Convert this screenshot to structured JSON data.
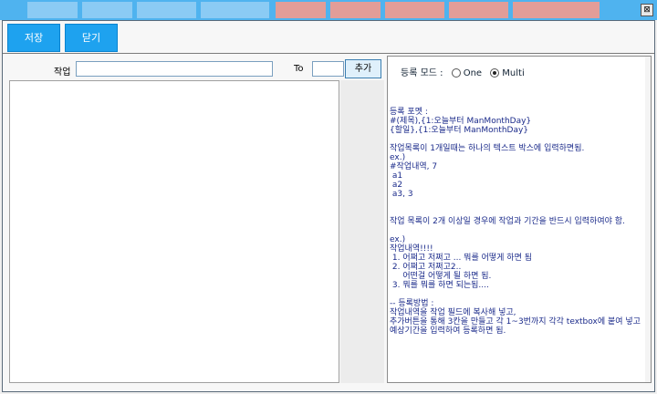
{
  "window": {
    "close_glyph": "⊠"
  },
  "toolbar": {
    "save_label": "저장",
    "close_label": "닫기"
  },
  "form": {
    "task_label": "작업",
    "task_value": "",
    "to_label": "To",
    "to_value": "",
    "add_label": "추가"
  },
  "mode": {
    "label": "등록 모드 :",
    "options": [
      "One",
      "Multi"
    ],
    "selected": "Multi"
  },
  "guide_text": "등록 포멧 :\n#(제목),{1:오늘부터 ManMonthDay}\n{할일},{1:오늘부터 ManMonthDay}\n\n작업목록이 1개일때는 하나의 텍스트 박스에 입력하면됨.\nex.)\n#작업내역, 7\n a1\n a2\n a3, 3\n\n\n작업 목록이 2개 이상일 경우에 작업과 기간을 반드시 입력하여야 함.\n\nex.)\n작업내역!!!!\n 1. 어쩌고 저쩌고 ... 뭐를 어떻게 하면 됨\n 2. 어쩌고 저쩌고2..\n     어떤걸 어떻게 될 하면 됨.\n 3. 뭐를 뭐를 하면 되는됨....\n\n-- 등록방법 :\n작업내역을 작업 필드에 복사해 넣고,\n추가버튼을 통해 3칸을 만들고 각 1~3번까지 각각 textbox에 붙여 넣고 예상기간을 입력하여 등록하면 됨.",
  "colors": {
    "toolbar_button": "#1ea2ef",
    "titlebar": "#4fb3ef",
    "guide_text": "#1a2a8a"
  }
}
